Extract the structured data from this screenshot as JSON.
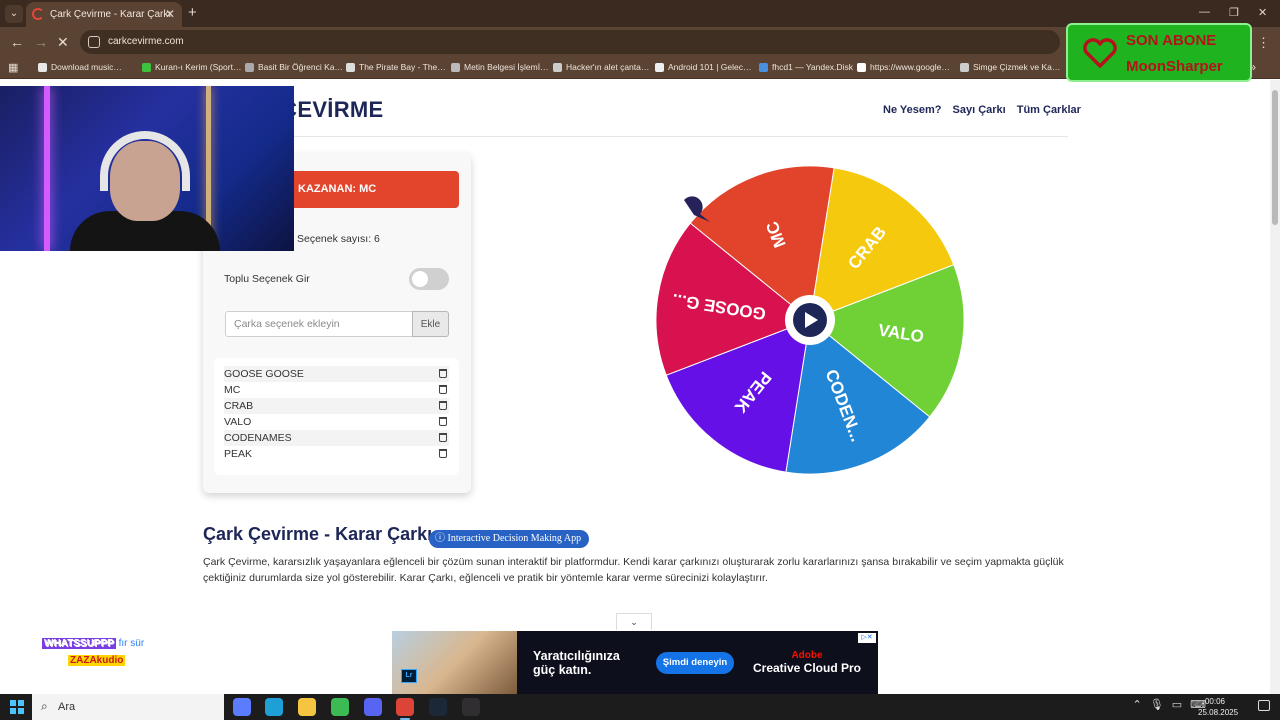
{
  "browser": {
    "tab_title": "Çark Çevirme - Karar Çarkı",
    "url": "carkcevirme.com",
    "bookmarks": [
      {
        "label": "Download music…",
        "color": "#e8e8e8"
      },
      {
        "label": "Kuran-ı Kerim (Sport…",
        "color": "#3ec23e"
      },
      {
        "label": "Basit Bir Öğrenci Ka…",
        "color": "#aaaaaa"
      },
      {
        "label": "The Pirate Bay - The…",
        "color": "#dddddd"
      },
      {
        "label": "Metin Belgesi İşlemİ…",
        "color": "#bbbbbb"
      },
      {
        "label": "Hacker'ın alet çanta…",
        "color": "#cccccc"
      },
      {
        "label": "Android 101 | Gelec…",
        "color": "#eeeeee"
      },
      {
        "label": "fhcd1 — Yandex.Disk",
        "color": "#4a90e2"
      },
      {
        "label": "https://www.google…",
        "color": "#ffffff"
      },
      {
        "label": "Simge Çizmek ve Ka…",
        "color": "#cccccc"
      }
    ]
  },
  "site": {
    "title": "ÇARK ÇEVİRME",
    "nav": [
      "Ne Yesem?",
      "Sayı Çarkı",
      "Tüm Çarklar"
    ]
  },
  "panel": {
    "winner": "KAZANAN: MC",
    "option_count": "Seçenek sayısı: 6",
    "bulk_label": "Toplu Seçenek Gir",
    "input_placeholder": "Çarka seçenek ekleyin",
    "add_label": "Ekle",
    "options": [
      "GOOSE GOOSE",
      "MC",
      "CRAB",
      "VALO",
      "CODENAMES",
      "PEAK"
    ]
  },
  "wheel": {
    "segments": [
      {
        "label": "CRAB",
        "color": "#f5c90e"
      },
      {
        "label": "VALO",
        "color": "#6fd136"
      },
      {
        "label": "CODEN...",
        "color": "#2186d6"
      },
      {
        "label": "PEAK",
        "color": "#6610e8"
      },
      {
        "label": "GOOSE G...",
        "color": "#d7124f"
      },
      {
        "label": "MC",
        "color": "#e1442b"
      }
    ]
  },
  "about": {
    "title": "Çark Çevirme - Karar Çarkı",
    "badge": "Interactive Decision Making App",
    "text": "Çark Çevirme, kararsızlık yaşayanlara eğlenceli bir çözüm sunan interaktif bir platformdur. Kendi karar çarkınızı oluşturarak zorlu kararlarınızı şansa bırakabilir ve seçim yapmakta güçlük çektiğiniz durumlarda size yol gösterebilir. Karar Çarkı, eğlenceli ve pratik bir yöntemle karar verme sürecinizi kolaylaştırır."
  },
  "ad": {
    "headline": "Yaratıcılığınıza güç katın.",
    "cta": "Şimdi deneyin",
    "brand_top": "Adobe",
    "brand_bottom": "Creative Cloud Pro",
    "badge": "Lr"
  },
  "overlay": {
    "sub_line1": "SON ABONE",
    "sub_line2": "MoonSharper",
    "chat_line1_name": "WHATSSUPPP",
    "chat_line1_rest": " fır sür",
    "chat_line2_name": "ZAZAkudio"
  },
  "taskbar": {
    "search": "Ara",
    "time": "00:06",
    "date": "25.08.2025",
    "apps": [
      {
        "name": "copilot-app",
        "color": "#5b7cff"
      },
      {
        "name": "edge-app",
        "color": "#1e9fd6"
      },
      {
        "name": "explorer-app",
        "color": "#f5c542"
      },
      {
        "name": "chrome-app",
        "color": "#3cba54"
      },
      {
        "name": "discord-app",
        "color": "#5865f2"
      },
      {
        "name": "chrome-active-app",
        "color": "#db4437"
      },
      {
        "name": "steam-app",
        "color": "#1b2838"
      },
      {
        "name": "obs-app",
        "color": "#302e31"
      }
    ]
  }
}
